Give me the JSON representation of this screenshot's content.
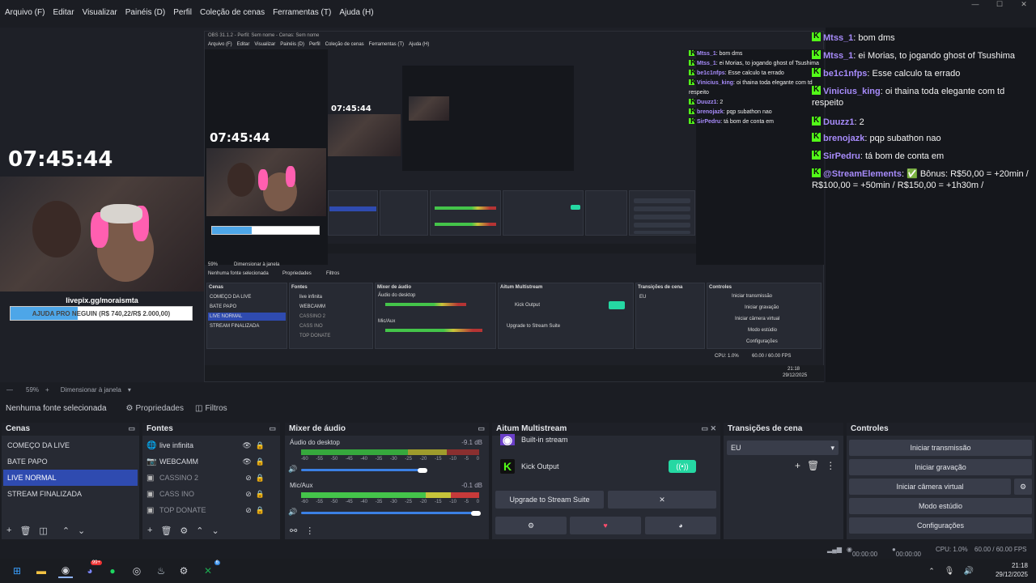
{
  "menu": [
    "Arquivo (F)",
    "Editar",
    "Visualizar",
    "Painéis (D)",
    "Perfil",
    "Coleção de cenas",
    "Ferramentas (T)",
    "Ajuda (H)"
  ],
  "window_controls": [
    "—",
    "☐",
    "✕"
  ],
  "preview": {
    "clock": "07:45:44",
    "livepix_url": "livepix.gg/moraismta",
    "goal_text": "AJUDA PRO NEGUIN (R$ 740,22/R$ 2.000,00)",
    "goal_progress": 0.37,
    "nested_title": "OBS 31.1.2 - Perfil: Sem nome - Cenas: Sem nome",
    "nested_menu": [
      "Arquivo (F)",
      "Editar",
      "Visualizar",
      "Painéis (D)",
      "Perfil",
      "Coleção de cenas",
      "Ferramentas (T)",
      "Ajuda (H)"
    ],
    "nested_no_source": "Nenhuma fonte selecionada",
    "nested_props": "Propriedades",
    "nested_filters": "Filtros",
    "nested_zoom": "59%",
    "nested_fit": "Dimensionar à janela",
    "nested_time": "21:18",
    "nested_date": "29/12/2025"
  },
  "chat": {
    "messages": [
      {
        "user": "Mtss_1",
        "text": "bom dms"
      },
      {
        "user": "Mtss_1",
        "text": "ei Morias, to jogando ghost of Tsushima"
      },
      {
        "user": "be1c1nfps",
        "text": "Esse calculo ta errado"
      },
      {
        "user": "Vinicius_king",
        "text": "oi thaina toda elegante com td respeito"
      },
      {
        "user": "Duuzz1",
        "text": "2"
      },
      {
        "user": "brenojazk",
        "text": "pqp subathon nao"
      },
      {
        "user": "SirPedru",
        "text": "tá bom de conta em"
      },
      {
        "user": "@StreamElements",
        "text": "✅ Bônus: R$50,00 = +20min / R$100,00 = +50min / R$150,00 = +1h30m /"
      }
    ]
  },
  "zoombar": {
    "zoom": "59%",
    "fit": "Dimensionar à janela"
  },
  "source_toolbar": {
    "no_source": "Nenhuma fonte selecionada",
    "properties": "Propriedades",
    "filters": "Filtros"
  },
  "scenes": {
    "title": "Cenas",
    "items": [
      "COMEÇO DA LIVE",
      "BATE PAPO",
      "LIVE NORMAL",
      "STREAM FINALIZADA"
    ],
    "selected": 2
  },
  "sources": {
    "title": "Fontes",
    "items": [
      {
        "name": "live infinita",
        "icon": "🌐",
        "hidden": false
      },
      {
        "name": "WEBCAMM",
        "icon": "📷",
        "hidden": false
      },
      {
        "name": "CASSINO 2",
        "icon": "▣",
        "hidden": true
      },
      {
        "name": "CASS INO",
        "icon": "▣",
        "hidden": true
      },
      {
        "name": "TOP DONATE",
        "icon": "▣",
        "hidden": true
      }
    ]
  },
  "mixer": {
    "title": "Mixer de áudio",
    "channels": [
      {
        "name": "Áudio do desktop",
        "db": "-9.1 dB",
        "level": 0.72,
        "volume": 0.68
      },
      {
        "name": "Mic/Aux",
        "db": "-0.1 dB",
        "level": 0.85,
        "volume": 0.98
      }
    ],
    "scale": [
      "-60",
      "-55",
      "-50",
      "-45",
      "-40",
      "-35",
      "-30",
      "-25",
      "-20",
      "-15",
      "-10",
      "-5",
      "0"
    ]
  },
  "multistream": {
    "title": "Aitum Multistream",
    "builtin_label": "Built-in stream",
    "output_label": "Kick Output",
    "upgrade_label": "Upgrade to Stream Suite",
    "close_label": "✕"
  },
  "transitions": {
    "title": "Transições de cena",
    "selected": "EU"
  },
  "controls": {
    "title": "Controles",
    "buttons": [
      "Iniciar transmissão",
      "Iniciar gravação",
      "Iniciar câmera virtual",
      "Modo estúdio",
      "Configurações"
    ]
  },
  "status": {
    "rec_time": "00:00:00",
    "stream_time": "00:00:00",
    "cpu": "CPU: 1.0%",
    "fps": "60.00 / 60.00 FPS"
  },
  "taskbar": {
    "time": "21:18",
    "date": "29/12/2025",
    "badge1": "99+",
    "badge2": "6"
  },
  "colors": {
    "accent": "#2f4bb0",
    "kick": "#53fc18",
    "toggle": "#25d8a3",
    "username": "#a78bfa"
  }
}
